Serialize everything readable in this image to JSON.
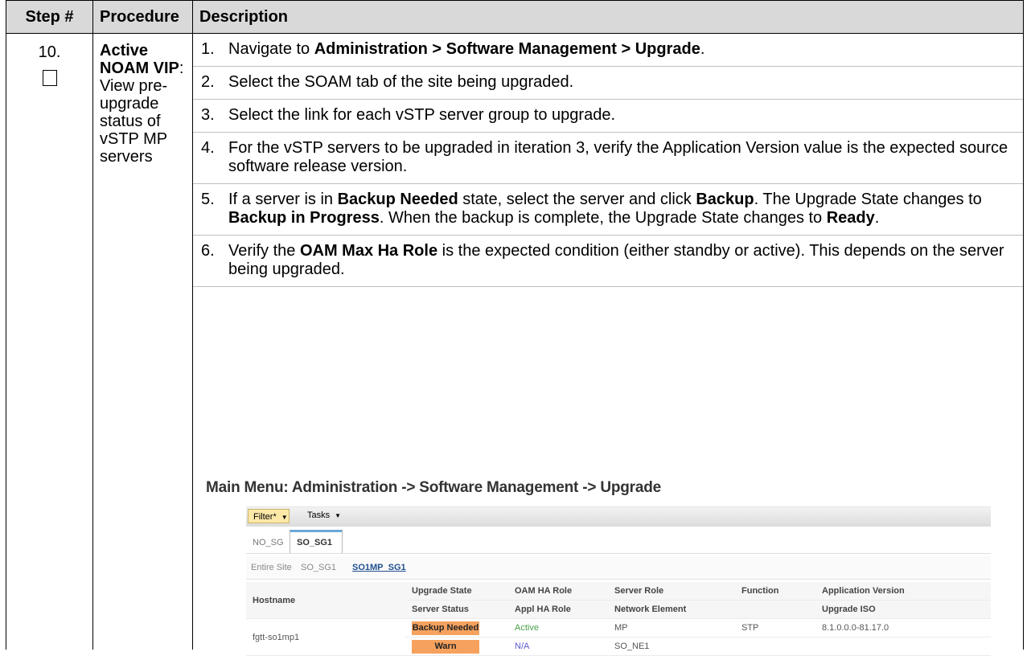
{
  "table": {
    "headers": [
      "Step #",
      "Procedure",
      "Description"
    ],
    "step_number": "10.",
    "procedure": {
      "bold": "Active NOAM VIP",
      "rest": ": View pre-upgrade status of vSTP MP servers"
    },
    "items": [
      {
        "num": "1.",
        "parts": [
          {
            "t": "Navigate to "
          },
          {
            "t": "Administration > Software Management > Upgrade",
            "b": true
          },
          {
            "t": "."
          }
        ]
      },
      {
        "num": "2.",
        "parts": [
          {
            "t": "Select the SOAM tab of the site being upgraded."
          }
        ]
      },
      {
        "num": "3.",
        "parts": [
          {
            "t": "Select the link for each vSTP server group to upgrade."
          }
        ]
      },
      {
        "num": "4.",
        "parts": [
          {
            "t": "For the vSTP servers to be upgraded in iteration 3, verify the Application Version value is the expected source software release version."
          }
        ]
      },
      {
        "num": "5.",
        "parts": [
          {
            "t": "If a server is in "
          },
          {
            "t": "Backup Needed",
            "b": true
          },
          {
            "t": " state, select the server and click "
          },
          {
            "t": "Backup",
            "b": true
          },
          {
            "t": ".  The Upgrade State changes to "
          },
          {
            "t": "Backup in Progress",
            "b": true
          },
          {
            "t": ".  When the backup is complete, the Upgrade State changes to "
          },
          {
            "t": "Ready",
            "b": true
          },
          {
            "t": "."
          }
        ]
      },
      {
        "num": "6.",
        "parts": [
          {
            "t": "Verify the "
          },
          {
            "t": "OAM Max Ha Role",
            "b": true
          },
          {
            "t": " is the expected condition (either standby or active).  This depends on the server being upgraded."
          }
        ]
      }
    ]
  },
  "screenshot": {
    "title": "Main Menu: Administration -> Software Management -> Upgrade",
    "filter_label": "Filter*",
    "tasks_label": "Tasks",
    "tabs": [
      "NO_SG",
      "SO_SG1"
    ],
    "subtabs": [
      "Entire Site",
      "SO_SG1",
      "SO1MP_SG1"
    ],
    "columns_row1": [
      "Hostname",
      "Upgrade State",
      "OAM HA Role",
      "Server Role",
      "Function",
      "Application Version"
    ],
    "columns_row2": [
      "Server Status",
      "Appl HA Role",
      "Network Element",
      "Upgrade ISO"
    ],
    "row": {
      "hostname": "fgtt-so1mp1",
      "upgrade_state": "Backup Needed",
      "oam_ha_role": "Active",
      "server_role": "MP",
      "function": "STP",
      "app_version": "8.1.0.0.0-81.17.0",
      "server_status": "Warn",
      "appl_ha_role": "N/A",
      "network_element": "SO_NE1",
      "upgrade_iso": ""
    },
    "colors": {
      "badge": "#f6a25e",
      "active": "#4aa04a",
      "na": "#5a5ad0",
      "filter": "#fce9a8"
    }
  }
}
